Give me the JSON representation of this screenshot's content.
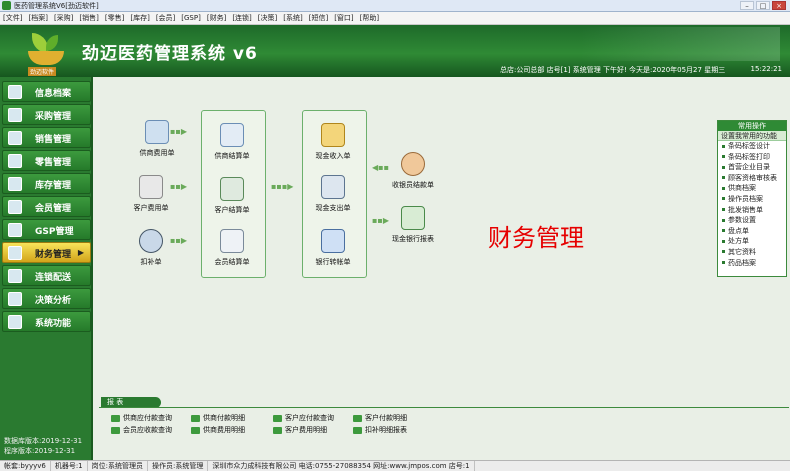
{
  "window": {
    "title": "医药管理系统V6[劲迈软件]"
  },
  "menu": [
    "[文件]",
    "[档案]",
    "[采购]",
    "[销售]",
    "[零售]",
    "[库存]",
    "[会员]",
    "[GSP]",
    "[财务]",
    "[连锁]",
    "[决策]",
    "[系统]",
    "[短信]",
    "[窗口]",
    "[帮助]"
  ],
  "header": {
    "logo_text": "劲迈软件",
    "app_title": "劲迈医药管理系统 v6",
    "status": "总店:公司总部  店号[1]  系统管理 下午好!  今天是:2020年05月27 星期三",
    "clock": "15:22:21"
  },
  "sidebar": {
    "items": [
      {
        "label": "信息档案"
      },
      {
        "label": "采购管理"
      },
      {
        "label": "销售管理"
      },
      {
        "label": "零售管理"
      },
      {
        "label": "库存管理"
      },
      {
        "label": "会员管理"
      },
      {
        "label": "GSP管理"
      },
      {
        "label": "财务管理"
      },
      {
        "label": "连锁配送"
      },
      {
        "label": "决策分析"
      },
      {
        "label": "系统功能"
      }
    ],
    "active_arrow": "▶",
    "expire_line1": "数据库版本:2019-12-31",
    "expire_line2": "程序版本:2019-12-31"
  },
  "main": {
    "title": "财务管理",
    "nodes": {
      "n1": "供商费用单",
      "n2": "客户费用单",
      "n3": "扣补单",
      "n4": "供商结算单",
      "n5": "客户结算单",
      "n6": "会员结算单",
      "n7": "现金收入单",
      "n8": "现金支出单",
      "n9": "银行转帐单",
      "n10": "收银员结款单",
      "n11": "现金银行报表"
    }
  },
  "right_panel": {
    "header": "常用操作",
    "setting": "设置我常用的功能",
    "items": [
      "条码标签设计",
      "条码标签打印",
      "首营企业目录",
      "顾客资格审核表",
      "供商档案",
      "操作员档案",
      "批发销售单",
      "参数设置",
      "盘点单",
      "处方单",
      "其它资料",
      "药品档案"
    ]
  },
  "reports": {
    "tag": "报 表",
    "links": [
      "供商应付款查询",
      "供商付款明细",
      "客户应付款查询",
      "客户付款明细",
      "会员应收款查询",
      "供商费用明细",
      "客户费用明细",
      "扣补明细报表"
    ]
  },
  "statusbar": [
    "帐套:byyyv6",
    "机器号:1",
    "岗位:系统管理员",
    "操作员:系统管理",
    "深圳市众力成科技有限公司 电话:0755-27088354 网址:www.jmpos.com 店号:1"
  ],
  "colors": {
    "accent_green": "#2f8a35",
    "active_yellow": "#f3d43a",
    "title_red": "#e60000"
  }
}
